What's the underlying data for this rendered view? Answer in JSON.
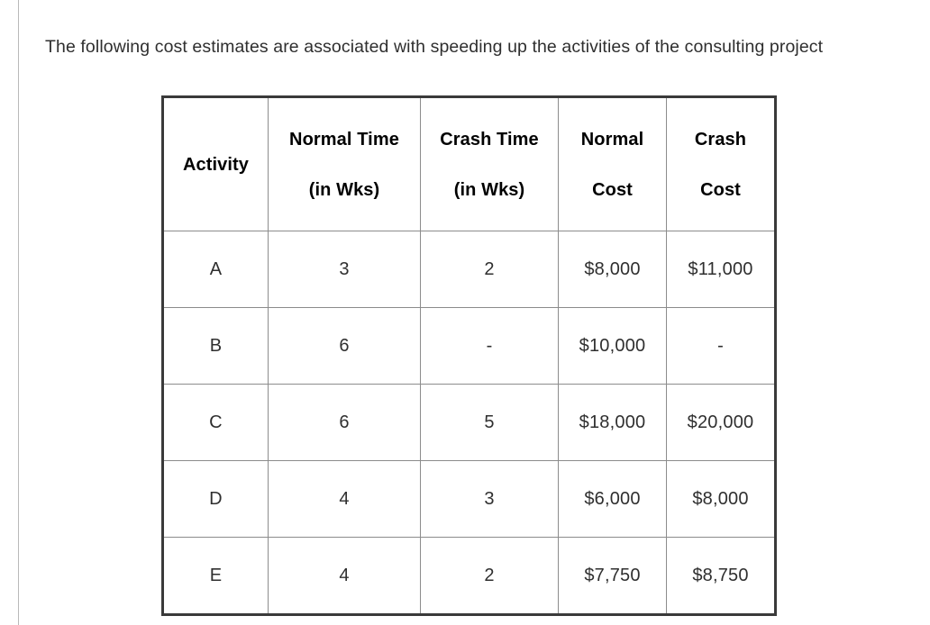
{
  "page": {
    "background_color": "#ffffff",
    "rule_color": "#b9b9b9"
  },
  "prompt": {
    "text": "The following cost estimates are associated with speeding up the activities of the consulting project"
  },
  "table": {
    "border_color": "#3a3a3a",
    "grid_color": "#8c8c8c",
    "headers": [
      {
        "line1": "Activity",
        "line2": ""
      },
      {
        "line1": "Normal Time",
        "line2": "(in Wks)"
      },
      {
        "line1": "Crash Time",
        "line2": "(in Wks)"
      },
      {
        "line1": "Normal",
        "line2": "Cost"
      },
      {
        "line1": "Crash",
        "line2": "Cost"
      }
    ],
    "rows": [
      {
        "activity": "A",
        "normal_time": "3",
        "crash_time": "2",
        "normal_cost": "$8,000",
        "crash_cost": "$11,000"
      },
      {
        "activity": "B",
        "normal_time": "6",
        "crash_time": "-",
        "normal_cost": "$10,000",
        "crash_cost": "-"
      },
      {
        "activity": "C",
        "normal_time": "6",
        "crash_time": "5",
        "normal_cost": "$18,000",
        "crash_cost": "$20,000"
      },
      {
        "activity": "D",
        "normal_time": "4",
        "crash_time": "3",
        "normal_cost": "$6,000",
        "crash_cost": "$8,000"
      },
      {
        "activity": "E",
        "normal_time": "4",
        "crash_time": "2",
        "normal_cost": "$7,750",
        "crash_cost": "$8,750"
      }
    ]
  }
}
